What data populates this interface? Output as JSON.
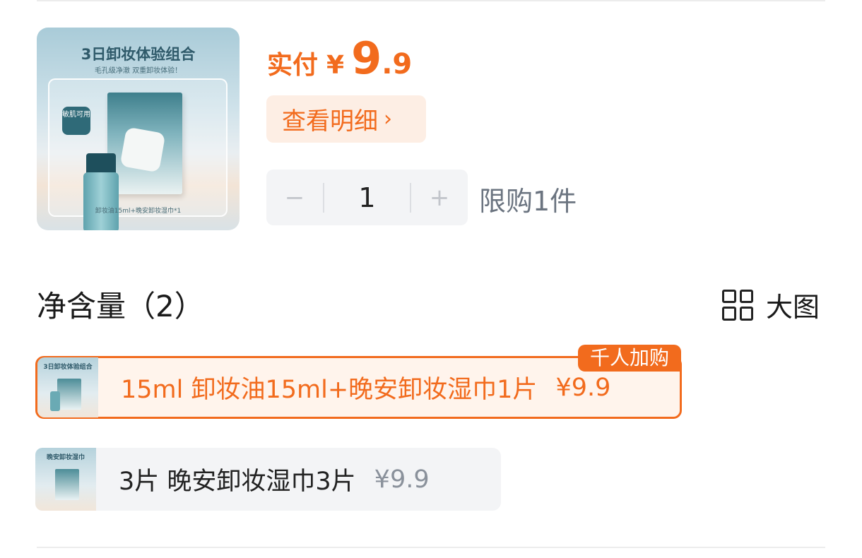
{
  "product": {
    "image_title": "3日卸妆体验组合",
    "image_subtitle": "毛孔级净澈 双重卸妆体验！",
    "image_badge": "敏肌可用",
    "image_footer": "卸妆油15ml+晚安卸妆湿巾*1"
  },
  "price": {
    "label": "实付",
    "currency": "¥",
    "integer": "9",
    "dot": ".",
    "decimal": "9"
  },
  "detail_button": {
    "label": "查看明细",
    "chevron": "›"
  },
  "stepper": {
    "minus": "−",
    "quantity": "1",
    "plus": "+"
  },
  "limit_text": "限购1件",
  "section": {
    "title": "净含量（2）",
    "big_view_label": "大图",
    "big_view_icon": "grid-icon"
  },
  "options": [
    {
      "label": "15ml 卸妆油15ml+晚安卸妆湿巾1片",
      "price": "¥9.9",
      "tag": "千人加购",
      "thumb_text": "3日卸妆体验组合",
      "selected": true
    },
    {
      "label": "3片 晚安卸妆湿巾3片",
      "price": "¥9.9",
      "thumb_text": "晚安卸妆湿巾",
      "selected": false
    }
  ],
  "colors": {
    "accent": "#f26b1d",
    "accent_bg": "#fdeee4",
    "neutral_bg": "#f3f4f6",
    "muted_text": "#6b7480"
  }
}
